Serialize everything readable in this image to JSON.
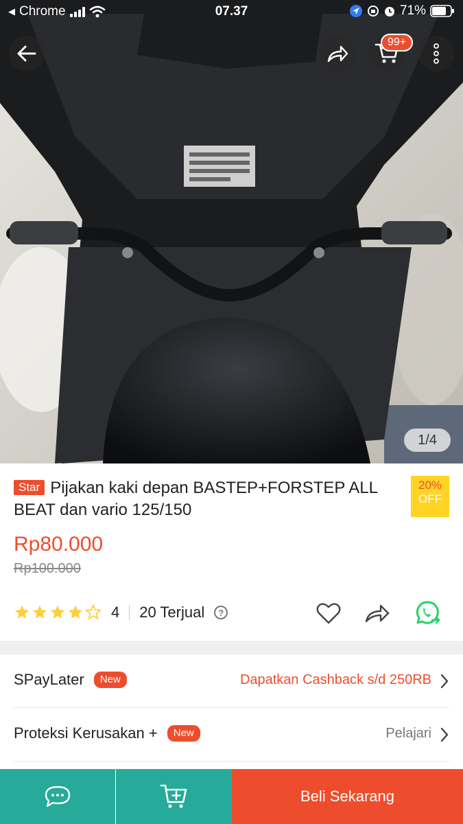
{
  "status_bar": {
    "back_app": "Chrome",
    "time": "07.37",
    "battery": "71%"
  },
  "gallery": {
    "counter": "1/4",
    "cart_badge": "99+"
  },
  "product": {
    "badge": "Star",
    "title": "Pijakan kaki depan BASTEP+FORSTEP ALL BEAT dan vario 125/150",
    "discount_pct": "20%",
    "discount_off": "OFF",
    "price": "Rp80.000",
    "original_price": "Rp100.000",
    "rating_value": 4,
    "rating_text": "4",
    "sold": "20 Terjual",
    "help_icon_text": "?"
  },
  "rows": [
    {
      "label": "SPayLater",
      "badge": "New",
      "value": "Dapatkan Cashback s/d 250RB",
      "value_color": "#ee4d2d"
    },
    {
      "label": "Proteksi Kerusakan +",
      "badge": "New",
      "value": "Pelajari",
      "value_color": "#777777"
    }
  ],
  "bottom_bar": {
    "buy_label": "Beli Sekarang"
  },
  "colors": {
    "accent": "#ee4d2d",
    "teal": "#26aa99",
    "star": "#ffce3d",
    "discount_bg": "#ffd424",
    "whatsapp": "#25d366"
  },
  "icons": [
    "back-arrow-icon",
    "share-icon",
    "cart-icon",
    "more-icon",
    "star-icon",
    "help-icon",
    "heart-icon",
    "share-icon",
    "whatsapp-icon",
    "chevron-right-icon",
    "chat-icon",
    "add-to-cart-icon"
  ]
}
